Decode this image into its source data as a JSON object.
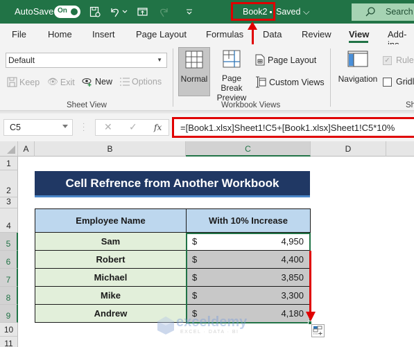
{
  "titlebar": {
    "autosave_label": "AutoSave",
    "autosave_state": "On",
    "document_name": "Book2",
    "save_status": "Saved",
    "search_label": "Search",
    "icons": [
      "save-icon",
      "undo-icon",
      "undo-dropdown-icon",
      "screen-icon",
      "redo-icon",
      "customize-toolbar-icon"
    ]
  },
  "ribbon_tabs": [
    {
      "label": "File"
    },
    {
      "label": "Home"
    },
    {
      "label": "Insert"
    },
    {
      "label": "Page Layout"
    },
    {
      "label": "Formulas"
    },
    {
      "label": "Data"
    },
    {
      "label": "Review"
    },
    {
      "label": "View",
      "active": true
    },
    {
      "label": "Add-ins"
    }
  ],
  "ribbon": {
    "sheet_view": {
      "group_label": "Sheet View",
      "selected_view": "Default",
      "buttons": [
        {
          "label": "Keep",
          "enabled": false
        },
        {
          "label": "Exit",
          "enabled": false
        },
        {
          "label": "New",
          "enabled": true
        },
        {
          "label": "Options",
          "enabled": false
        }
      ]
    },
    "workbook_views": {
      "group_label": "Workbook Views",
      "normal": "Normal",
      "page_break_line1": "Page Break",
      "page_break_line2": "Preview",
      "page_layout": "Page Layout",
      "custom_views": "Custom Views"
    },
    "show": {
      "group_label": "Sh",
      "navigation": "Navigation",
      "ruler": {
        "label": "Ruler",
        "checked": true,
        "enabled": false
      },
      "gridlines": {
        "label": "Gridli",
        "checked": false,
        "enabled": true
      }
    }
  },
  "formula_bar": {
    "name_box": "C5",
    "cancel": "✕",
    "enter": "✓",
    "fx": "fx",
    "formula": "=[Book1.xlsx]Sheet1!C5+[Book1.xlsx]Sheet1!C5*10%"
  },
  "grid": {
    "columns": [
      "A",
      "B",
      "C",
      "D"
    ],
    "selected_column": "C",
    "rows": [
      "1",
      "2",
      "3",
      "4",
      "5",
      "6",
      "7",
      "8",
      "9",
      "10",
      "11"
    ],
    "selected_rows": [
      "5",
      "6",
      "7",
      "8",
      "9"
    ]
  },
  "sheet": {
    "title": "Cell Refrence from Another Workbook",
    "headers": [
      "Employee Name",
      "With 10% Increase"
    ],
    "currency_symbol": "$",
    "rows": [
      {
        "name": "Sam",
        "amount": "4,950"
      },
      {
        "name": "Robert",
        "amount": "4,400"
      },
      {
        "name": "Michael",
        "amount": "3,850"
      },
      {
        "name": "Mike",
        "amount": "3,300"
      },
      {
        "name": "Andrew",
        "amount": "4,180"
      }
    ]
  },
  "watermark": {
    "brand": "exceldemy",
    "tagline": "EXCEL · DATA · BI"
  },
  "colors": {
    "excel_green": "#217346",
    "annotation_red": "#e00000",
    "title_fill": "#203864",
    "header_fill": "#bdd7ee",
    "name_fill": "#e2efda"
  }
}
